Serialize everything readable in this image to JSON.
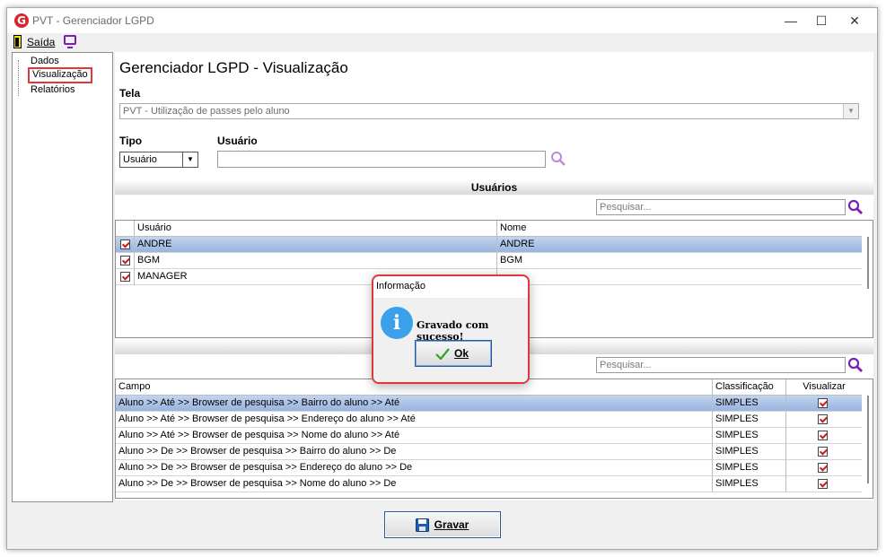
{
  "window": {
    "title": "PVT - Gerenciador LGPD",
    "app_icon_letter": "G",
    "min_glyph": "—",
    "max_glyph": "☐",
    "close_glyph": "✕"
  },
  "menu": {
    "exit_label": "Saída"
  },
  "nav": {
    "items": [
      "Dados",
      "Visualização",
      "Relatórios"
    ],
    "selected": "Visualização"
  },
  "main": {
    "heading": "Gerenciador LGPD - Visualização",
    "tela_label": "Tela",
    "tela_value": "PVT - Utilização de passes pelo aluno",
    "tipo_label": "Tipo",
    "tipo_value": "Usuário",
    "usuario_label": "Usuário",
    "usuario_value": ""
  },
  "usuarios_section": {
    "title": "Usuários",
    "search_placeholder": "Pesquisar...",
    "columns": [
      "Usuário",
      "Nome"
    ],
    "rows": [
      {
        "usuario": "ANDRE",
        "nome": "ANDRE",
        "checked": true,
        "selected": true
      },
      {
        "usuario": "BGM",
        "nome": "BGM",
        "checked": true,
        "selected": false
      },
      {
        "usuario": "MANAGER",
        "nome": "",
        "checked": true,
        "selected": false
      }
    ]
  },
  "campos_section": {
    "search_placeholder": "Pesquisar...",
    "columns": [
      "Campo",
      "Classificação",
      "Visualizar"
    ],
    "rows": [
      {
        "campo": "Aluno >> Até >> Browser de pesquisa >> Bairro do aluno >> Até",
        "classificacao": "SIMPLES",
        "visualizar": true,
        "selected": true
      },
      {
        "campo": "Aluno >> Até >> Browser de pesquisa >> Endereço do aluno >> Até",
        "classificacao": "SIMPLES",
        "visualizar": true,
        "selected": false
      },
      {
        "campo": "Aluno >> Até >> Browser de pesquisa >> Nome do aluno >> Até",
        "classificacao": "SIMPLES",
        "visualizar": true,
        "selected": false
      },
      {
        "campo": "Aluno >> De >> Browser de pesquisa >> Bairro do aluno >> De",
        "classificacao": "SIMPLES",
        "visualizar": true,
        "selected": false
      },
      {
        "campo": "Aluno >> De >> Browser de pesquisa >> Endereço do aluno >> De",
        "classificacao": "SIMPLES",
        "visualizar": true,
        "selected": false
      },
      {
        "campo": "Aluno >> De >> Browser de pesquisa >> Nome do aluno >> De",
        "classificacao": "SIMPLES",
        "visualizar": true,
        "selected": false
      }
    ]
  },
  "footer": {
    "save_label": "Gravar"
  },
  "dialog": {
    "title": "Informação",
    "icon": "info-icon",
    "icon_glyph": "i",
    "message": "Gravado com sucesso!",
    "ok_label": "Ok"
  },
  "colors": {
    "highlight_border": "#e0363d",
    "selection_row": "#a9c0e5",
    "search_icon": "#7a1fb0",
    "info_icon": "#3aa0ea",
    "check_mark": "#c81e1e"
  }
}
